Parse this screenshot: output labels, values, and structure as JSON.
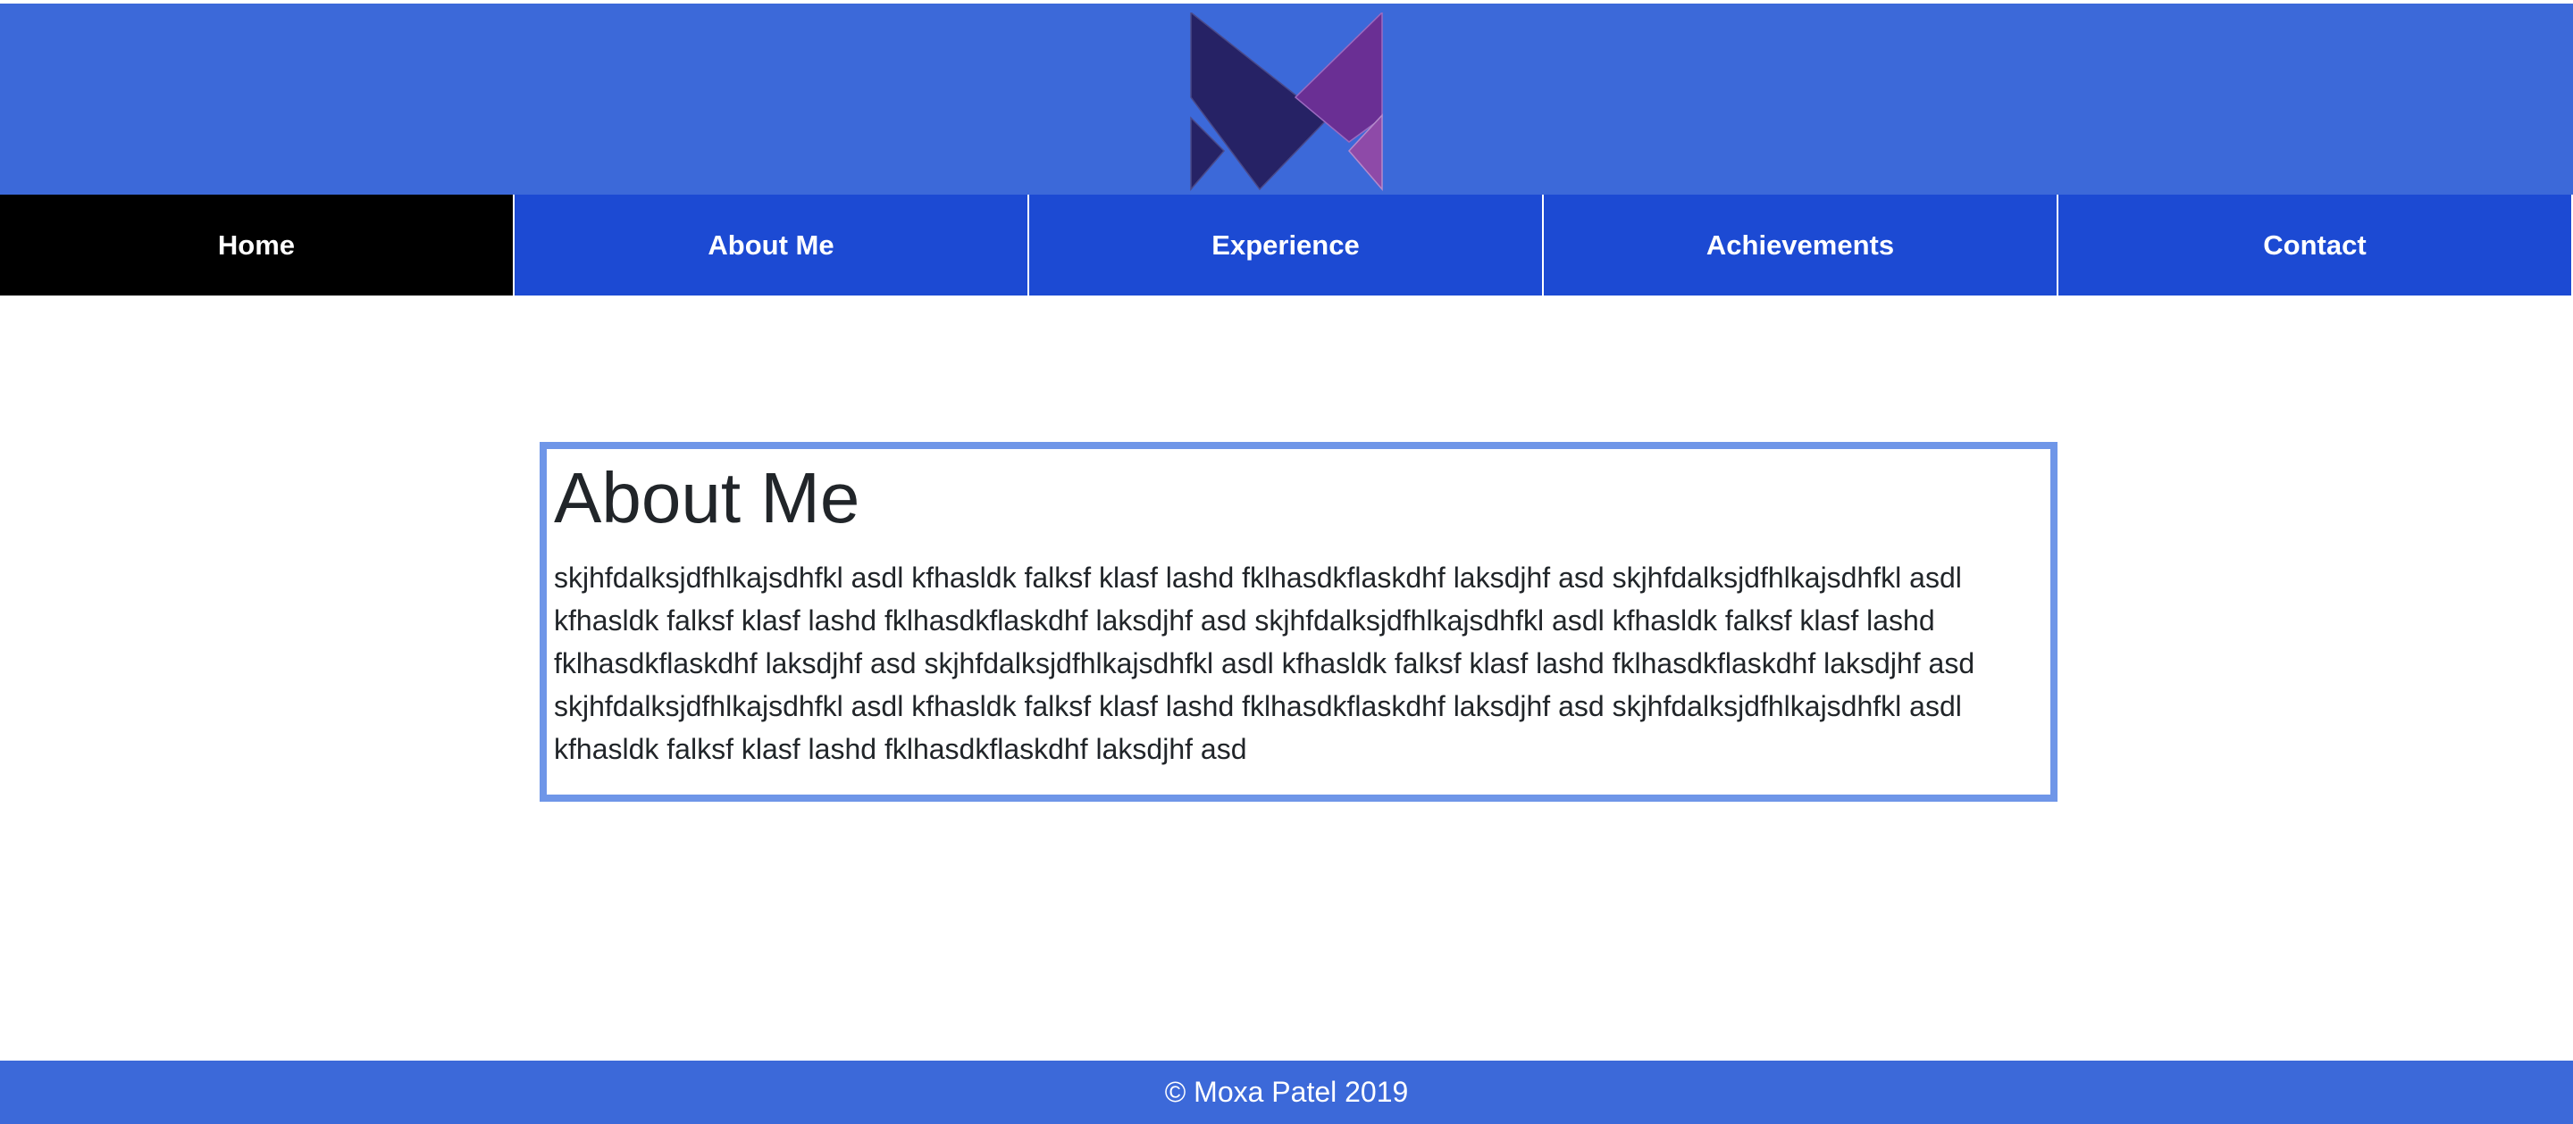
{
  "logo": {
    "icon": "mp-monogram-logo",
    "colors": {
      "dark": "#262265",
      "purple": "#6a2f94",
      "light_purple": "#8e4aa8"
    }
  },
  "nav": {
    "items": [
      {
        "label": "Home",
        "active": true
      },
      {
        "label": "About Me",
        "active": false
      },
      {
        "label": "Experience",
        "active": false
      },
      {
        "label": "Achievements",
        "active": false
      },
      {
        "label": "Contact",
        "active": false
      }
    ]
  },
  "about": {
    "title": "About Me",
    "body": "skjhfdalksjdfhlkajsdhfkl asdl kfhasldk falksf klasf lashd fklhasdkflaskdhf laksdjhf asd skjhfdalksjdfhlkajsdhfkl asdl kfhasldk falksf klasf lashd fklhasdkflaskdhf laksdjhf asd skjhfdalksjdfhlkajsdhfkl asdl kfhasldk falksf klasf lashd fklhasdkflaskdhf laksdjhf asd skjhfdalksjdfhlkajsdhfkl asdl kfhasldk falksf klasf lashd fklhasdkflaskdhf laksdjhf asd skjhfdalksjdfhlkajsdhfkl asdl kfhasldk falksf klasf lashd fklhasdkflaskdhf laksdjhf asd skjhfdalksjdfhlkajsdhfkl asdl kfhasldk falksf klasf lashd fklhasdkflaskdhf laksdjhf asd"
  },
  "footer": {
    "text": "© Moxa Patel 2019"
  },
  "colors": {
    "header_bg": "#3c69d9",
    "nav_bg": "#1c4ad3",
    "nav_active_bg": "#000000",
    "box_border": "#6f96e8",
    "footer_bg": "#3c69d9"
  }
}
